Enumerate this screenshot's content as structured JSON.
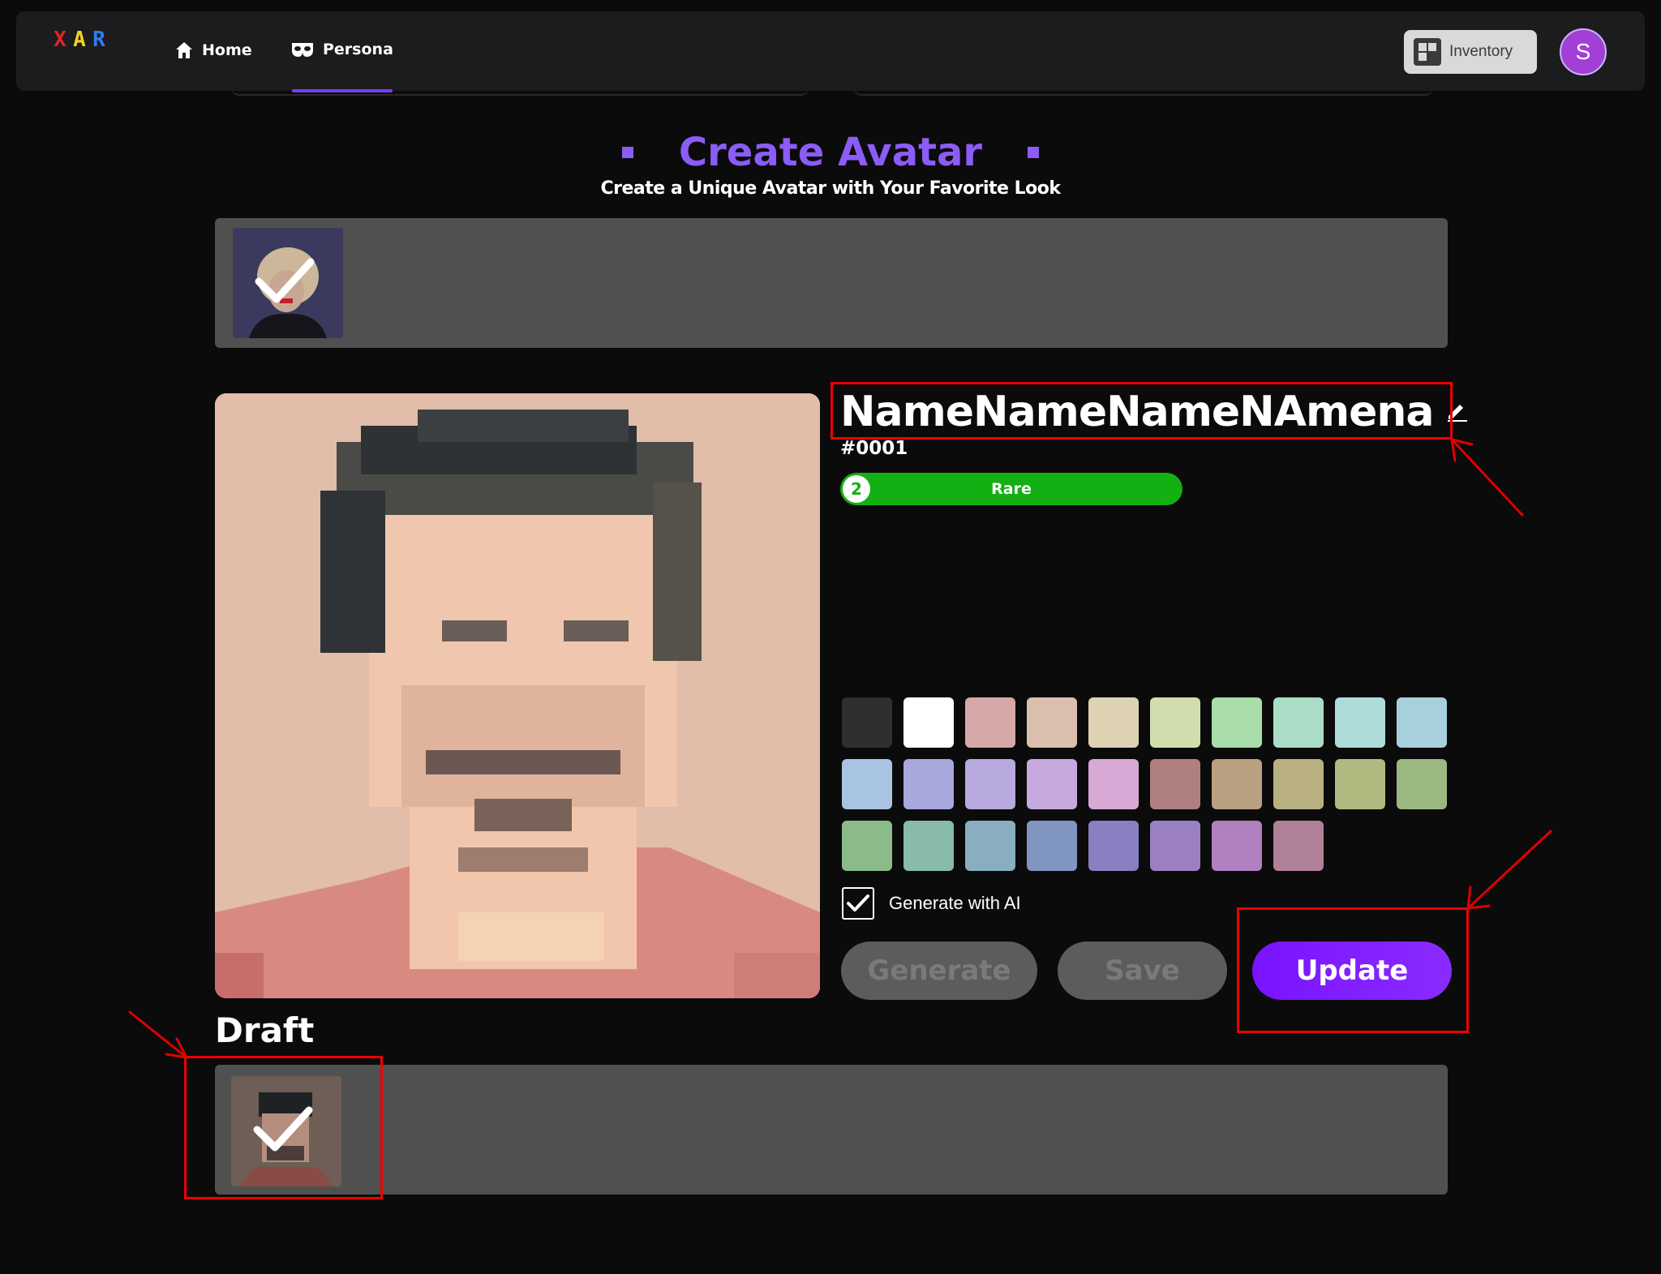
{
  "nav": {
    "logo_letters": [
      "X",
      "A",
      "R"
    ],
    "logo_colors": [
      "#e02424",
      "#f3d31a",
      "#2f7df0"
    ],
    "home_label": "Home",
    "persona_label": "Persona",
    "inventory_label": "Inventory",
    "avatar_initial": "S"
  },
  "header": {
    "title": "Create Avatar",
    "subtitle": "Create a Unique Avatar with Your Favorite Look"
  },
  "avatar": {
    "name": "NameNameNameNAmena",
    "id_tag": "#0001",
    "level": "2",
    "rarity": "Rare"
  },
  "palette": [
    "#2f2f2f",
    "#ffffff",
    "#d6a8a8",
    "#dbbfae",
    "#ddd3b2",
    "#d2ddae",
    "#a9dda9",
    "#a9ddc6",
    "#aedcda",
    "#a8d0dc",
    "#a9c4e3",
    "#a8a8dd",
    "#b8a9de",
    "#c6a9de",
    "#d8a9d4",
    "#b08080",
    "#b8a080",
    "#b8b080",
    "#b0ba80",
    "#9ab880",
    "#8abb88",
    "#88bba8",
    "#88aec0",
    "#8096c0",
    "#8880c0",
    "#9a80c0",
    "#b080c0",
    "#b08098"
  ],
  "controls": {
    "generate_with_ai_label": "Generate with AI",
    "generate_with_ai_checked": true,
    "generate_label": "Generate",
    "save_label": "Save",
    "update_label": "Update"
  },
  "draft": {
    "label": "Draft"
  },
  "colors": {
    "accent": "#8b5cf6",
    "rarity_green": "#12b012",
    "update_purple": "#7a13ff",
    "annotation_red": "#e00000"
  }
}
